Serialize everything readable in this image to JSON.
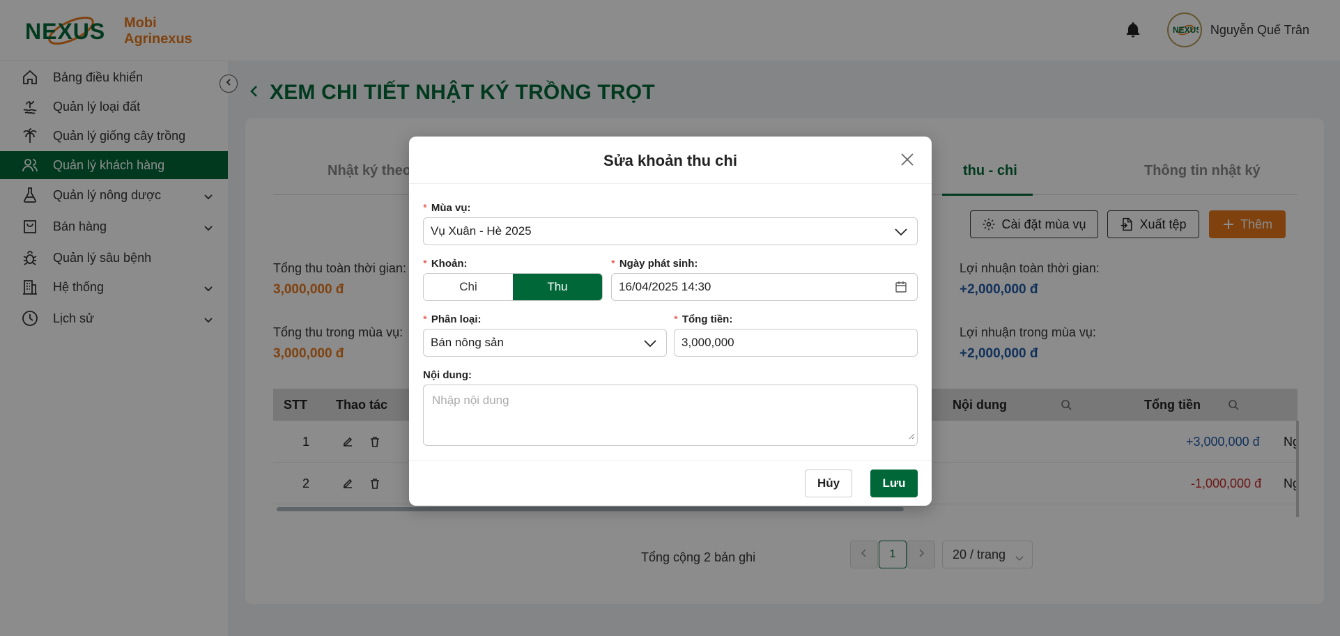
{
  "brand": {
    "name_line1": "Mobi",
    "name_line2": "Agrinexus",
    "logo_text": "NEXUS",
    "accent": "#006838",
    "orange": "#e8791d"
  },
  "user": {
    "name": "Nguyễn Quế Trân"
  },
  "sidebar": {
    "items": [
      {
        "label": "Bảng điều khiển",
        "icon": "home-icon"
      },
      {
        "label": "Quản lý loại đất",
        "icon": "soil-icon"
      },
      {
        "label": "Quản lý giống cây trồng",
        "icon": "palm-tree-icon"
      },
      {
        "label": "Quản lý khách hàng",
        "icon": "users-icon",
        "active": true
      },
      {
        "label": "Quản lý nông dược",
        "icon": "flask-icon",
        "expandable": true
      },
      {
        "label": "Bán hàng",
        "icon": "shopping-bag-icon",
        "expandable": true
      },
      {
        "label": "Quản lý sâu bệnh",
        "icon": "bug-icon"
      },
      {
        "label": "Hệ thống",
        "icon": "building-icon",
        "expandable": true
      },
      {
        "label": "Lịch sử",
        "icon": "clock-icon",
        "expandable": true
      }
    ]
  },
  "page": {
    "title": "XEM CHI TIẾT NHẬT KÝ TRỒNG TRỌT"
  },
  "tabs": [
    {
      "label": "Nhật ký theo"
    },
    {
      "label": "thu - chi"
    },
    {
      "label": "Thông tin nhật ký"
    }
  ],
  "toolbar": {
    "settings_label": "Cài đặt mùa vụ",
    "export_label": "Xuất tệp",
    "add_label": "Thêm"
  },
  "stats": {
    "total_income_all_label": "Tổng thu toàn thời gian:",
    "total_income_all_value": "3,000,000 đ",
    "total_income_season_label": "Tổng thu trong mùa vụ:",
    "total_income_season_value": "3,000,000 đ",
    "profit_all_label": "Lợi nhuận toàn thời gian:",
    "profit_all_value": "+2,000,000 đ",
    "profit_season_label": "Lợi nhuận trong mùa vụ:",
    "profit_season_value": "+2,000,000 đ"
  },
  "table": {
    "columns": {
      "stt": "STT",
      "actions": "Thao tác",
      "content": "Nội dung",
      "total": "Tổng tiền"
    },
    "rows": [
      {
        "stt": "1",
        "total": "+3,000,000 đ",
        "extra": "Ng"
      },
      {
        "stt": "2",
        "total": "-1,000,000 đ",
        "extra": "Ng"
      }
    ]
  },
  "pagination": {
    "total": "Tổng cộng 2 bản ghi",
    "current_page": "1",
    "page_size": "20 / trang"
  },
  "modal": {
    "title": "Sửa khoản thu chi",
    "season_label": "Mùa vụ:",
    "season_value": "Vụ Xuân - Hè 2025",
    "type_label": "Khoản:",
    "type_options": [
      "Chi",
      "Thu"
    ],
    "type_selected": "Thu",
    "date_label": "Ngày phát sinh:",
    "date_value": "16/04/2025 14:30",
    "category_label": "Phân loại:",
    "category_value": "Bán nông sản",
    "amount_label": "Tổng tiền:",
    "amount_value": "3,000,000",
    "content_label": "Nội dung:",
    "content_placeholder": "Nhập nội dung",
    "cancel_label": "Hủy",
    "save_label": "Lưu"
  }
}
